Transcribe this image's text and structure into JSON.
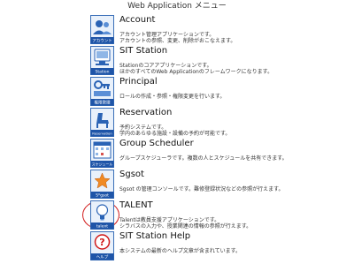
{
  "page": {
    "title": "Web Application メニュー"
  },
  "apps": [
    {
      "name": "Account",
      "icon_label": "アカウント",
      "icon": "account-icon",
      "desc": [
        "アカウント管理アプリケーションです。",
        "アカウントの参照、変更、削除がおこなえます。"
      ]
    },
    {
      "name": "SIT Station",
      "icon_label": "Station",
      "icon": "station-icon",
      "desc": [
        "Stationのコアアプリケーションです。",
        "ほかのすべてのWeb Applicationのフレームワークになります。"
      ]
    },
    {
      "name": "Principal",
      "icon_label": "権限管理",
      "icon": "principal-icon",
      "desc": [
        "ロールの作成・参照・権限変更を行います。",
        ""
      ]
    },
    {
      "name": "Reservation",
      "icon_label": "Reservation",
      "icon": "reservation-icon",
      "desc": [
        "予約システムです。",
        "学内のあらゆる施設・設備の予約が可能です。"
      ]
    },
    {
      "name": "Group Scheduler",
      "icon_label": "スケジュール",
      "icon": "scheduler-icon",
      "desc": [
        "グループスケジューラです。複数の人とスケジュールを共有できます。",
        ""
      ]
    },
    {
      "name": "Sgsot",
      "icon_label": "S*gsot",
      "icon": "sgsot-icon",
      "desc": [
        "Sgsot の管理コンソールです。難修登録状況などの参照が行えます。",
        ""
      ]
    },
    {
      "name": "TALENT",
      "icon_label": "talent",
      "icon": "talent-icon",
      "desc": [
        "Talentは教員支援アプリケーションです。",
        "シラバスの入力や、授業関連の情報の参照が行えます。"
      ]
    },
    {
      "name": "SIT Station Help",
      "icon_label": "ヘルプ",
      "icon": "help-icon",
      "desc": [
        "本システムの最新のヘルプ文章が含まれています。",
        ""
      ]
    }
  ],
  "colors": {
    "icon_bg": "#e9f1fb",
    "icon_border": "#3a6fb8",
    "icon_label_bg": "#1f55a8",
    "highlight": "#d11a1a"
  }
}
